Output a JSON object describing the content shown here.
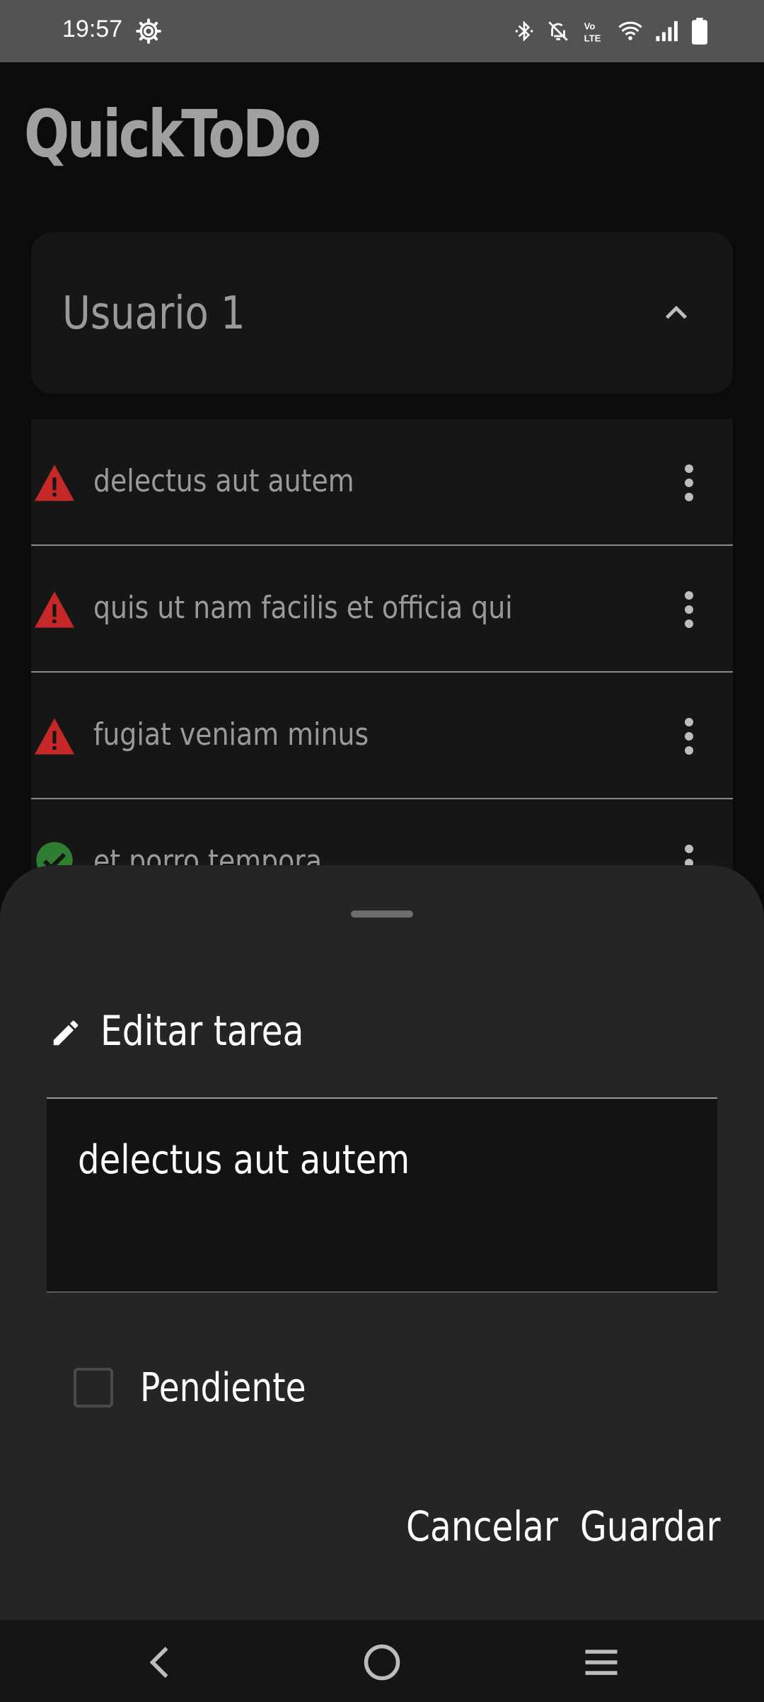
{
  "status_bar": {
    "time": "19:57"
  },
  "app": {
    "title": "QuickToDo",
    "user_section": {
      "name": "Usuario 1",
      "expanded": true
    },
    "tasks": [
      {
        "text": "delectus aut autem",
        "status": "warning"
      },
      {
        "text": "quis ut nam facilis et officia qui",
        "status": "warning"
      },
      {
        "text": "fugiat veniam minus",
        "status": "warning"
      },
      {
        "text": "et porro tempora",
        "status": "done"
      }
    ]
  },
  "sheet": {
    "title": "Editar tarea",
    "task_text_value": "delectus aut autem",
    "checkbox_label": "Pendiente",
    "checkbox_checked": false,
    "cancel_label": "Cancelar",
    "save_label": "Guardar"
  },
  "colors": {
    "warning": "#c62828",
    "done": "#2e7d32",
    "sheet_bg": "#252525",
    "status_bar_bg": "#535353"
  }
}
